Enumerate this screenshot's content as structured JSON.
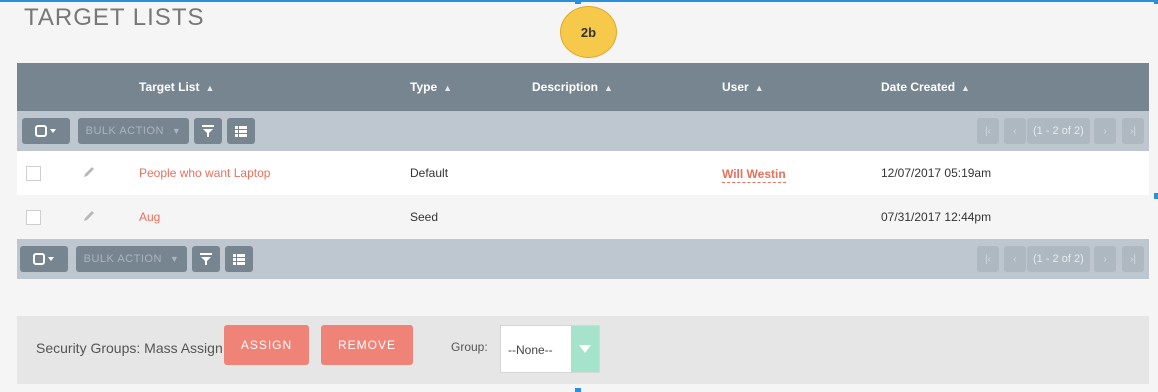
{
  "page": {
    "title": "TARGET LISTS",
    "badge": "2b"
  },
  "table": {
    "columns": [
      {
        "label": "Target List"
      },
      {
        "label": "Type"
      },
      {
        "label": "Description"
      },
      {
        "label": "User"
      },
      {
        "label": "Date Created"
      }
    ],
    "bulk_action_label": "BULK ACTION",
    "pagination": "(1 - 2 of 2)",
    "rows": [
      {
        "name": "People who want Laptop",
        "type": "Default",
        "description": "",
        "user": "Will Westin",
        "date": "12/07/2017 05:19am"
      },
      {
        "name": "Aug",
        "type": "Seed",
        "description": "",
        "user": "",
        "date": "07/31/2017 12:44pm"
      }
    ]
  },
  "mass_assign": {
    "label": "Security Groups: Mass Assign",
    "assign_label": "ASSIGN",
    "remove_label": "REMOVE",
    "group_label": "Group:",
    "group_value": "--None--"
  },
  "colors": {
    "header_bg": "#778591",
    "actionbar_bg": "#bec7cf",
    "link": "#e8705d",
    "button": "#f08377",
    "badge": "#f6c94b",
    "select_caret": "#a5e3cd"
  },
  "icons": [
    "checkbox-icon",
    "caret-down-icon",
    "filter-icon",
    "list-view-icon",
    "first-page-icon",
    "prev-page-icon",
    "next-page-icon",
    "last-page-icon",
    "pencil-icon",
    "sort-icon"
  ]
}
